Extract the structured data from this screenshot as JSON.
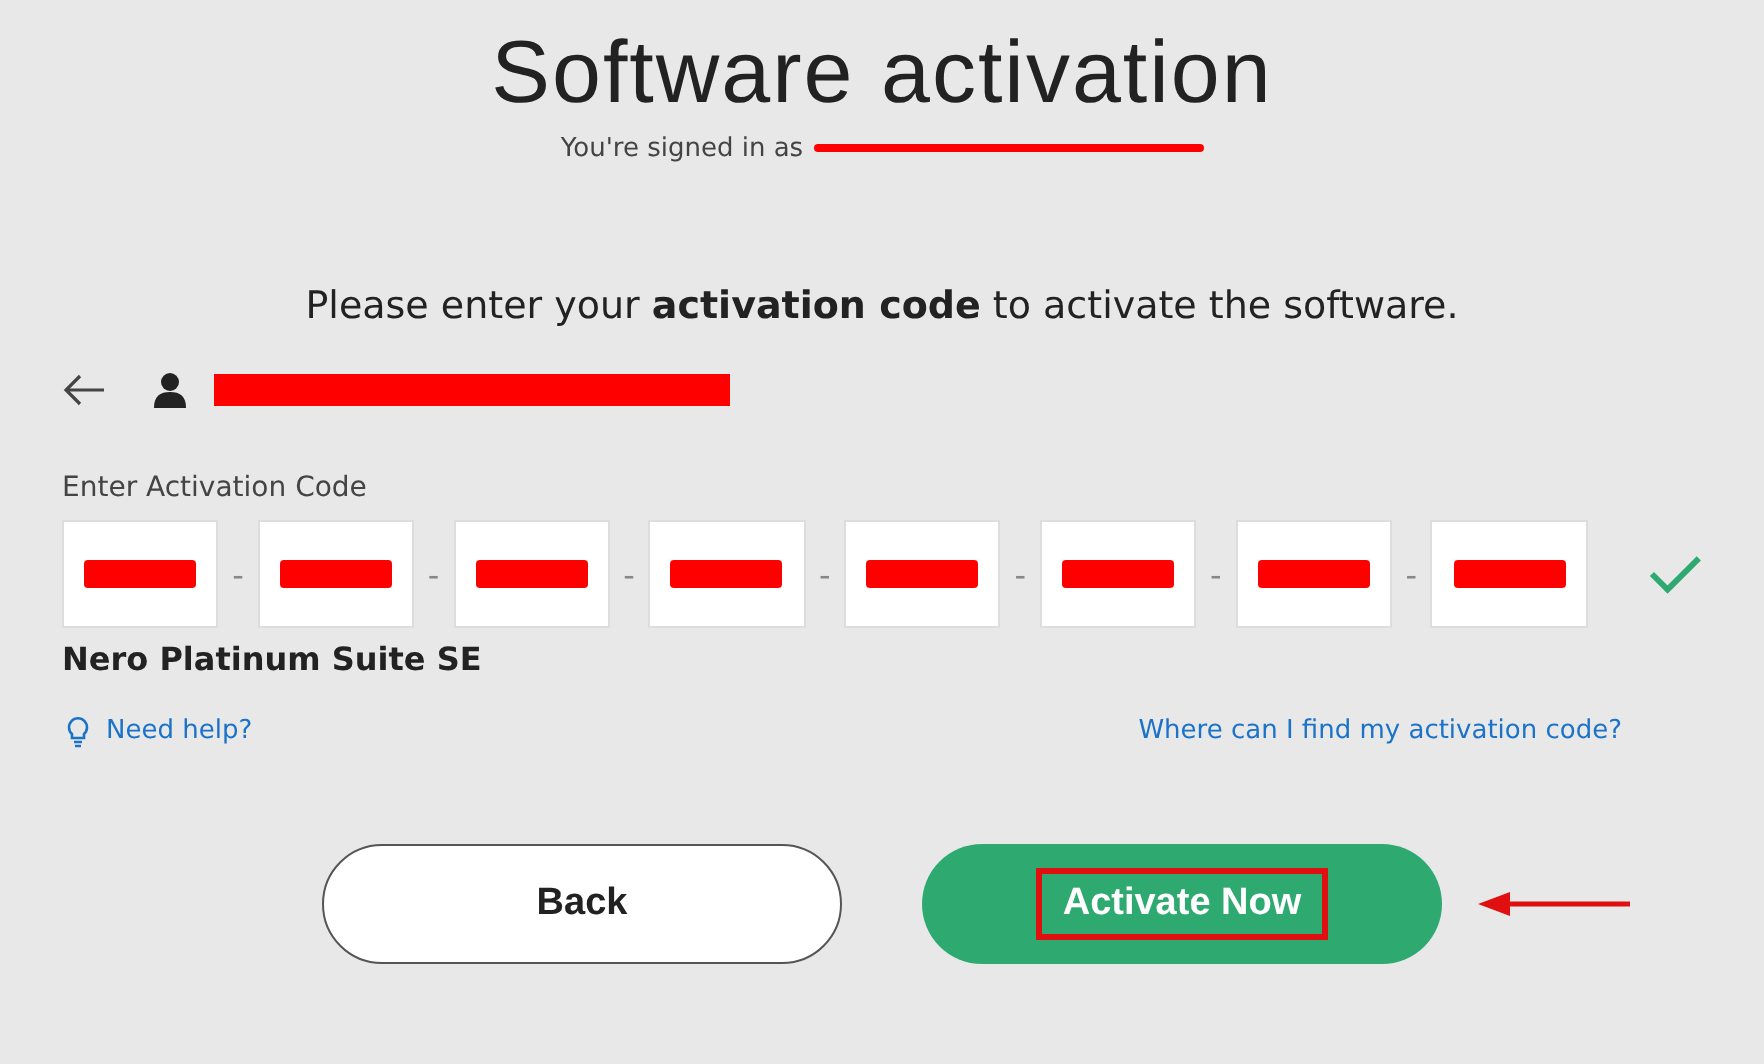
{
  "title": "Software activation",
  "signed_in": {
    "label": "You're signed in as",
    "email_redacted": true
  },
  "prompt": "Please enter your **activation code** to activate the software.",
  "account": {
    "redacted": true
  },
  "code": {
    "label": "Enter Activation Code",
    "valid": true,
    "fields": [
      {
        "redacted": true
      },
      {
        "redacted": true
      },
      {
        "redacted": true
      },
      {
        "redacted": true
      },
      {
        "redacted": true
      },
      {
        "redacted": true
      },
      {
        "redacted": true
      },
      {
        "redacted": true
      }
    ],
    "separator": "-"
  },
  "product": "Nero Platinum Suite SE",
  "help_link": "Need help?",
  "where_link": "Where can I find my activation code?",
  "buttons": [
    {
      "kind": "secondary",
      "label": "Back"
    },
    {
      "kind": "primary",
      "label": "Activate Now",
      "highlighted": true,
      "arrow": true
    }
  ]
}
